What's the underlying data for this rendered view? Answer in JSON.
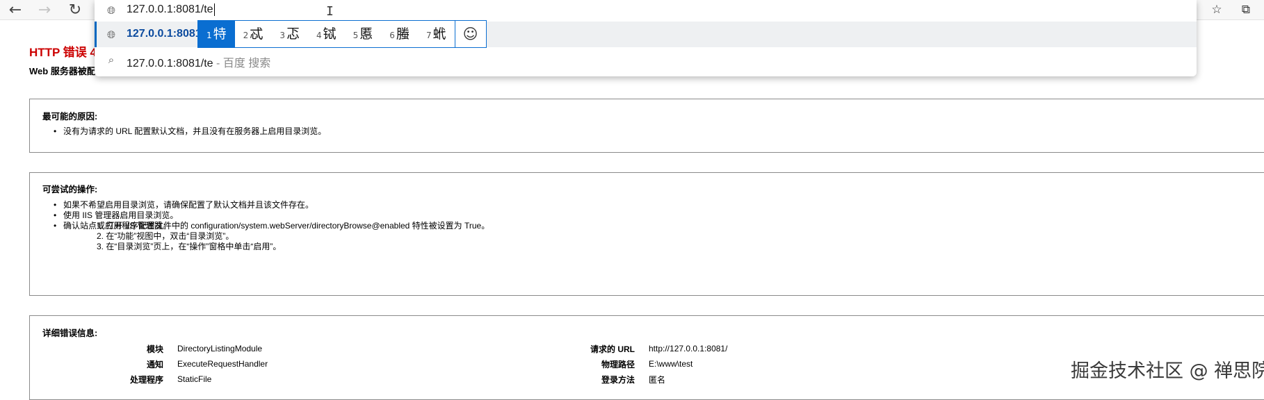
{
  "browser": {
    "nav_icons": {
      "back": "back-arrow-icon",
      "forward": "forward-arrow-icon",
      "refresh": "refresh-icon"
    },
    "right_icons": [
      "favorites-icon",
      "collections-icon"
    ],
    "address": {
      "input_value": "127.0.0.1:8081/te",
      "suggestion_url": "127.0.0.1:8081",
      "search_query": "127.0.0.1:8081/te",
      "search_hint": " - 百度 搜索"
    },
    "ime": {
      "candidates": [
        {
          "num": "1",
          "char": "特"
        },
        {
          "num": "2",
          "char": "忒"
        },
        {
          "num": "3",
          "char": "忑"
        },
        {
          "num": "4",
          "char": "铽"
        },
        {
          "num": "5",
          "char": "慝"
        },
        {
          "num": "6",
          "char": "螣"
        },
        {
          "num": "7",
          "char": "蚮"
        }
      ],
      "emoji_icon": "emoji-smiley-icon"
    }
  },
  "page": {
    "title": "HTTP 错误 4",
    "subtitle": "Web 服务器被配",
    "cause": {
      "heading": "最可能的原因:",
      "items": [
        "没有为请求的 URL 配置默认文档，并且没有在服务器上启用目录浏览。"
      ]
    },
    "actions": {
      "heading": "可尝试的操作:",
      "item1": "如果不希望启用目录浏览，请确保配置了默认文档并且该文件存在。",
      "item2": "使用 IIS 管理器启用目录浏览。",
      "steps": [
        "1. 打开 IIS 管理器。",
        "2. 在“功能”视图中，双击“目录浏览”。",
        "3. 在“目录浏览”页上，在“操作”窗格中单击“启用”。"
      ],
      "item3": "确认站点或应用程序配置文件中的 configuration/system.webServer/directoryBrowse@enabled 特性被设置为 True。"
    },
    "details": {
      "heading": "详细错误信息:",
      "left": [
        {
          "k": "模块",
          "v": "DirectoryListingModule"
        },
        {
          "k": "通知",
          "v": "ExecuteRequestHandler"
        },
        {
          "k": "处理程序",
          "v": "StaticFile"
        }
      ],
      "right": [
        {
          "k": "请求的 URL",
          "v": "http://127.0.0.1:8081/"
        },
        {
          "k": "物理路径",
          "v": "E:\\www\\test"
        },
        {
          "k": "登录方法",
          "v": "匿名"
        }
      ]
    }
  },
  "watermark": "掘金技术社区 @ 禅思院"
}
